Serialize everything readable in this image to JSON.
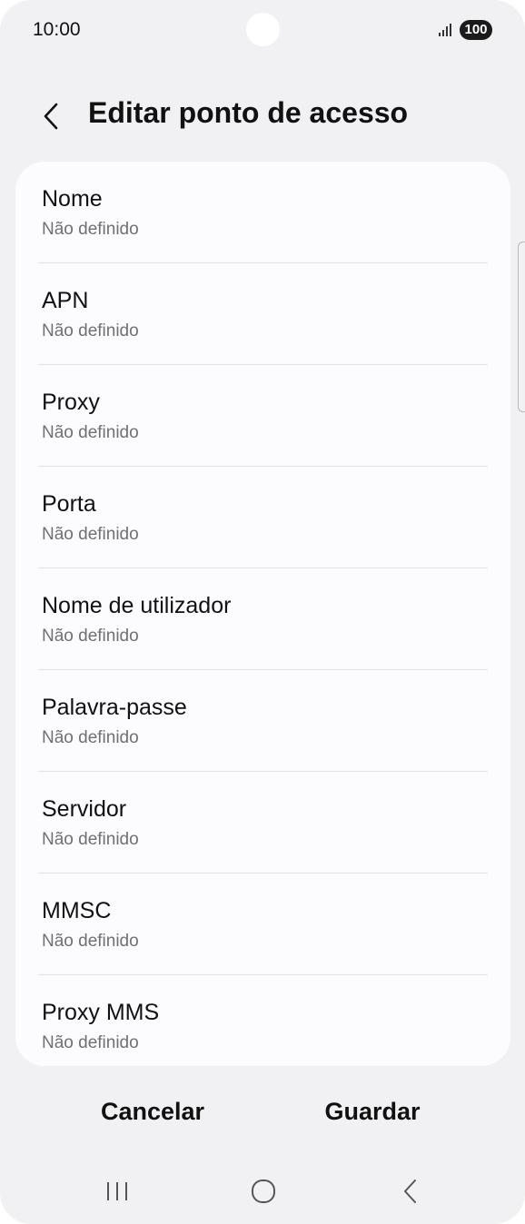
{
  "status_bar": {
    "time": "10:00",
    "battery": "100",
    "signal_icon": "signal-bars-icon"
  },
  "header": {
    "back_icon": "chevron-left-icon",
    "title": "Editar ponto de acesso"
  },
  "fields": [
    {
      "label": "Nome",
      "value": "Não definido"
    },
    {
      "label": "APN",
      "value": "Não definido"
    },
    {
      "label": "Proxy",
      "value": "Não definido"
    },
    {
      "label": "Porta",
      "value": "Não definido"
    },
    {
      "label": "Nome de utilizador",
      "value": "Não definido"
    },
    {
      "label": "Palavra-passe",
      "value": "Não definido"
    },
    {
      "label": "Servidor",
      "value": "Não definido"
    },
    {
      "label": "MMSC",
      "value": "Não definido"
    },
    {
      "label": "Proxy MMS",
      "value": "Não definido"
    }
  ],
  "actions": {
    "cancel_label": "Cancelar",
    "save_label": "Guardar"
  },
  "nav_bar": {
    "recents_icon": "recents-icon",
    "home_icon": "home-icon",
    "back_icon": "back-icon"
  },
  "colors": {
    "background": "#f1f1f3",
    "card": "#fcfcff",
    "text_primary": "#111111",
    "text_secondary": "#6f6f75",
    "divider": "#e0e0e4"
  }
}
